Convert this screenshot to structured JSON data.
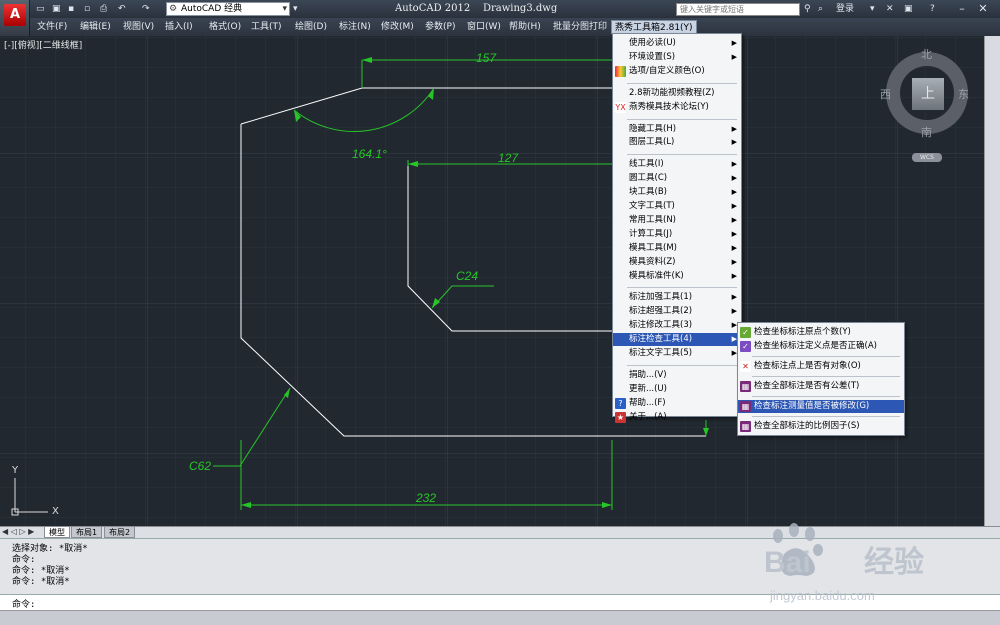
{
  "window": {
    "title": "AutoCAD 2012",
    "document": "Drawing3.dwg",
    "workspace": "AutoCAD 经典",
    "search_placeholder": "键入关键字或短语",
    "login": "登录"
  },
  "menubar": [
    "文件(F)",
    "编辑(E)",
    "视图(V)",
    "插入(I)",
    "格式(O)",
    "工具(T)",
    "绘图(D)",
    "标注(N)",
    "修改(M)",
    "参数(P)",
    "窗口(W)",
    "帮助(H)",
    "批量分图打印",
    "燕秀工具箱2.81(Y)"
  ],
  "viewport_label": "[-][俯视][二维线框]",
  "drawing": {
    "dims": [
      "157",
      "164.1°",
      "127",
      "C24",
      "C62",
      "232"
    ],
    "ucs": {
      "x": "X",
      "y": "Y"
    }
  },
  "viewcube": {
    "north": "北",
    "south": "南",
    "east": "东",
    "west": "西",
    "face": "上",
    "wcs": "WCS"
  },
  "main_menu": [
    {
      "label": "使用必读(U)",
      "sub": true
    },
    {
      "label": "环境设置(S)",
      "sub": true
    },
    {
      "label": "选项/自定义颜色(O)",
      "icon": "options"
    },
    {
      "sep": true
    },
    {
      "label": "2.8新功能视频教程(Z)"
    },
    {
      "label": "燕秀模具技术论坛(Y)",
      "icon": "yx"
    },
    {
      "sep": true
    },
    {
      "label": "隐藏工具(H)",
      "sub": true
    },
    {
      "label": "图层工具(L)",
      "sub": true
    },
    {
      "sep": true
    },
    {
      "label": "线工具(I)",
      "sub": true
    },
    {
      "label": "圆工具(C)",
      "sub": true
    },
    {
      "label": "块工具(B)",
      "sub": true
    },
    {
      "label": "文字工具(T)",
      "sub": true
    },
    {
      "label": "常用工具(N)",
      "sub": true
    },
    {
      "label": "计算工具(J)",
      "sub": true
    },
    {
      "label": "模具工具(M)",
      "sub": true
    },
    {
      "label": "模具资料(Z)",
      "sub": true
    },
    {
      "label": "模具标准件(K)",
      "sub": true
    },
    {
      "sep": true
    },
    {
      "label": "标注加强工具(1)",
      "sub": true
    },
    {
      "label": "标注超强工具(2)",
      "sub": true
    },
    {
      "label": "标注修改工具(3)",
      "sub": true
    },
    {
      "label": "标注检查工具(4)",
      "sub": true,
      "hl": true
    },
    {
      "label": "标注文字工具(5)",
      "sub": true
    },
    {
      "sep": true
    },
    {
      "label": "捐助...(V)"
    },
    {
      "label": "更新...(U)"
    },
    {
      "label": "帮助...(F)",
      "icon": "help"
    },
    {
      "label": "关于...(A)",
      "icon": "about"
    }
  ],
  "sub_menu": [
    {
      "label": "检查坐标标注原点个数(Y)",
      "icon": "check1"
    },
    {
      "label": "检查坐标标注定义点是否正确(A)",
      "icon": "check2"
    },
    {
      "sep": true
    },
    {
      "label": "检查标注点上是否有对象(O)",
      "icon": "check3"
    },
    {
      "sep": true
    },
    {
      "label": "检查全部标注是否有公差(T)",
      "icon": "check4"
    },
    {
      "sep": true
    },
    {
      "label": "检查标注测量值是否被修改(G)",
      "icon": "check5",
      "hl": true
    },
    {
      "sep": true
    },
    {
      "label": "检查全部标注的比例因子(S)",
      "icon": "check6"
    }
  ],
  "layout_tabs": [
    "模型",
    "布局1",
    "布局2"
  ],
  "command_history": [
    "选择对象: *取消*",
    "命令:",
    "命令: *取消*",
    "命令: *取消*"
  ],
  "command_prompt": "命令:",
  "watermark": {
    "brand": "Bai",
    "brand2": "经验",
    "url": "jingyan.baidu.com"
  },
  "colors": {
    "dimension": "#27c627",
    "geometry": "#ffffff",
    "highlight": "#2d57b5",
    "background": "#212830"
  }
}
